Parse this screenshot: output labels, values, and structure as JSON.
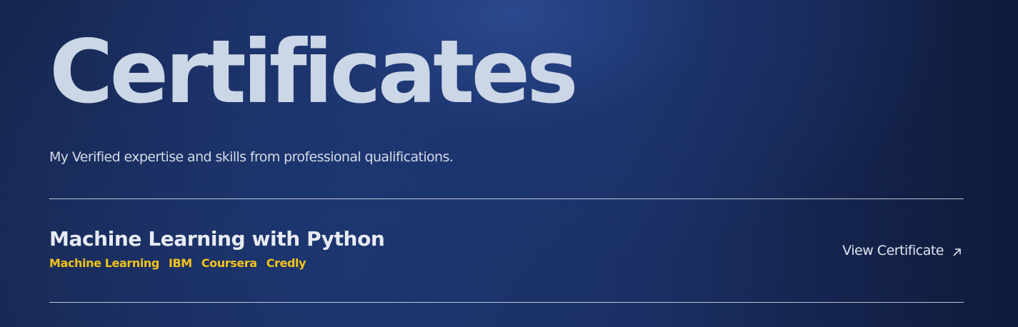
{
  "header": {
    "title": "Certificates",
    "subtitle": "My Verified expertise and skills from professional qualifications."
  },
  "certificates": [
    {
      "title": "Machine Learning with Python",
      "tags": [
        "Machine Learning",
        "IBM",
        "Coursera",
        "Credly"
      ],
      "link_label": "View Certificate",
      "link_icon": "external-link-arrow-icon"
    }
  ],
  "colors": {
    "background": "#1c3269",
    "title": "#cbd6e6",
    "text": "#d5dbe6",
    "accent": "#f2c21b",
    "divider": "#e1e8f5"
  }
}
